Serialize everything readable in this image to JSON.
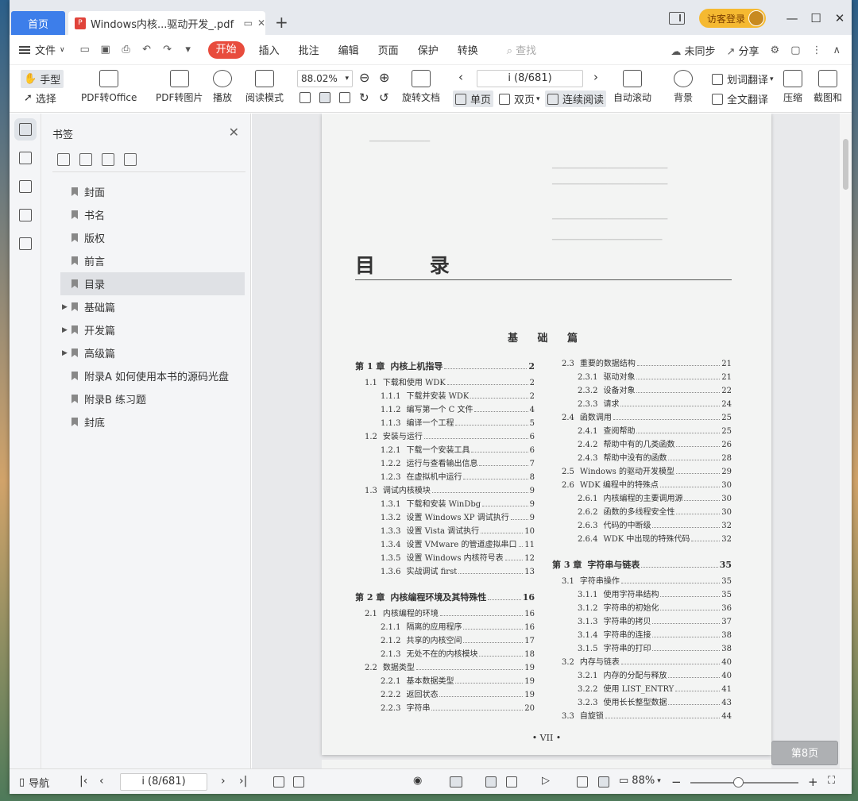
{
  "titlebar": {
    "home_tab": "首页",
    "doc_tab": "Windows内核...驱动开发_.pdf",
    "guest_login": "访客登录"
  },
  "menubar": {
    "file": "文件",
    "tabs": [
      "开始",
      "插入",
      "批注",
      "编辑",
      "页面",
      "保护",
      "转换"
    ],
    "search_placeholder": "查找",
    "sync": "未同步",
    "share": "分享"
  },
  "toolbar": {
    "hand": "手型",
    "select": "选择",
    "pdf_to_office": "PDF转Office",
    "pdf_to_image": "PDF转图片",
    "play": "播放",
    "read_mode": "阅读模式",
    "zoom": "88.02%",
    "page_indicator": "i (8/681)",
    "rotate": "旋转文档",
    "single": "单页",
    "double": "双页",
    "continuous": "连续阅读",
    "autoscroll": "自动滚动",
    "background": "背景",
    "word_translate": "划词翻译",
    "full_translate": "全文翻译",
    "compress": "压缩",
    "screenshot": "截图和"
  },
  "sidebar": {
    "title": "书签",
    "bookmarks": [
      {
        "label": "封面",
        "expandable": false
      },
      {
        "label": "书名",
        "expandable": false
      },
      {
        "label": "版权",
        "expandable": false
      },
      {
        "label": "前言",
        "expandable": false
      },
      {
        "label": "目录",
        "expandable": false,
        "selected": true
      },
      {
        "label": "基础篇",
        "expandable": true
      },
      {
        "label": "开发篇",
        "expandable": true
      },
      {
        "label": "高级篇",
        "expandable": true
      },
      {
        "label": "附录A  如何使用本书的源码光盘",
        "expandable": false
      },
      {
        "label": "附录B  练习题",
        "expandable": false
      },
      {
        "label": "封底",
        "expandable": false
      }
    ]
  },
  "page": {
    "title": "目 录",
    "section": "基 础 篇",
    "folio": "• VII •",
    "badge": "第8页",
    "left_col": [
      {
        "level": 0,
        "num": "第 1 章",
        "text": "内核上机指导",
        "page": "2"
      },
      {
        "level": 1,
        "num": "1.1",
        "text": "下载和使用 WDK",
        "page": "2"
      },
      {
        "level": 2,
        "num": "1.1.1",
        "text": "下载并安装 WDK",
        "page": "2"
      },
      {
        "level": 2,
        "num": "1.1.2",
        "text": "编写第一个 C 文件",
        "page": "4"
      },
      {
        "level": 2,
        "num": "1.1.3",
        "text": "编译一个工程",
        "page": "5"
      },
      {
        "level": 1,
        "num": "1.2",
        "text": "安装与运行",
        "page": "6"
      },
      {
        "level": 2,
        "num": "1.2.1",
        "text": "下载一个安装工具",
        "page": "6"
      },
      {
        "level": 2,
        "num": "1.2.2",
        "text": "运行与查看输出信息",
        "page": "7"
      },
      {
        "level": 2,
        "num": "1.2.3",
        "text": "在虚拟机中运行",
        "page": "8"
      },
      {
        "level": 1,
        "num": "1.3",
        "text": "调试内核模块",
        "page": "9"
      },
      {
        "level": 2,
        "num": "1.3.1",
        "text": "下载和安装 WinDbg",
        "page": "9"
      },
      {
        "level": 2,
        "num": "1.3.2",
        "text": "设置 Windows XP 调试执行",
        "page": "9"
      },
      {
        "level": 2,
        "num": "1.3.3",
        "text": "设置 Vista 调试执行",
        "page": "10"
      },
      {
        "level": 2,
        "num": "1.3.4",
        "text": "设置 VMware 的管道虚拟串口",
        "page": "11"
      },
      {
        "level": 2,
        "num": "1.3.5",
        "text": "设置 Windows 内核符号表",
        "page": "12"
      },
      {
        "level": 2,
        "num": "1.3.6",
        "text": "实战调试 first",
        "page": "13"
      },
      {
        "level": 0,
        "num": "第 2 章",
        "text": "内核编程环境及其特殊性",
        "page": "16",
        "gap": true
      },
      {
        "level": 1,
        "num": "2.1",
        "text": "内核编程的环境",
        "page": "16"
      },
      {
        "level": 2,
        "num": "2.1.1",
        "text": "隔离的应用程序",
        "page": "16"
      },
      {
        "level": 2,
        "num": "2.1.2",
        "text": "共享的内核空间",
        "page": "17"
      },
      {
        "level": 2,
        "num": "2.1.3",
        "text": "无处不在的内核模块",
        "page": "18"
      },
      {
        "level": 1,
        "num": "2.2",
        "text": "数据类型",
        "page": "19"
      },
      {
        "level": 2,
        "num": "2.2.1",
        "text": "基本数据类型",
        "page": "19"
      },
      {
        "level": 2,
        "num": "2.2.2",
        "text": "返回状态",
        "page": "19"
      },
      {
        "level": 2,
        "num": "2.2.3",
        "text": "字符串",
        "page": "20"
      }
    ],
    "right_col": [
      {
        "level": 1,
        "num": "2.3",
        "text": "重要的数据结构",
        "page": "21"
      },
      {
        "level": 2,
        "num": "2.3.1",
        "text": "驱动对象",
        "page": "21"
      },
      {
        "level": 2,
        "num": "2.3.2",
        "text": "设备对象",
        "page": "22"
      },
      {
        "level": 2,
        "num": "2.3.3",
        "text": "请求",
        "page": "24"
      },
      {
        "level": 1,
        "num": "2.4",
        "text": "函数调用",
        "page": "25"
      },
      {
        "level": 2,
        "num": "2.4.1",
        "text": "查阅帮助",
        "page": "25"
      },
      {
        "level": 2,
        "num": "2.4.2",
        "text": "帮助中有的几类函数",
        "page": "26"
      },
      {
        "level": 2,
        "num": "2.4.3",
        "text": "帮助中没有的函数",
        "page": "28"
      },
      {
        "level": 1,
        "num": "2.5",
        "text": "Windows 的驱动开发模型",
        "page": "29"
      },
      {
        "level": 1,
        "num": "2.6",
        "text": "WDK 编程中的特殊点",
        "page": "30"
      },
      {
        "level": 2,
        "num": "2.6.1",
        "text": "内核编程的主要调用源",
        "page": "30"
      },
      {
        "level": 2,
        "num": "2.6.2",
        "text": "函数的多线程安全性",
        "page": "30"
      },
      {
        "level": 2,
        "num": "2.6.3",
        "text": "代码的中断级",
        "page": "32"
      },
      {
        "level": 2,
        "num": "2.6.4",
        "text": "WDK 中出现的特殊代码",
        "page": "32"
      },
      {
        "level": 0,
        "num": "第 3 章",
        "text": "字符串与链表",
        "page": "35",
        "gap": true
      },
      {
        "level": 1,
        "num": "3.1",
        "text": "字符串操作",
        "page": "35"
      },
      {
        "level": 2,
        "num": "3.1.1",
        "text": "使用字符串结构",
        "page": "35"
      },
      {
        "level": 2,
        "num": "3.1.2",
        "text": "字符串的初始化",
        "page": "36"
      },
      {
        "level": 2,
        "num": "3.1.3",
        "text": "字符串的拷贝",
        "page": "37"
      },
      {
        "level": 2,
        "num": "3.1.4",
        "text": "字符串的连接",
        "page": "38"
      },
      {
        "level": 2,
        "num": "3.1.5",
        "text": "字符串的打印",
        "page": "38"
      },
      {
        "level": 1,
        "num": "3.2",
        "text": "内存与链表",
        "page": "40"
      },
      {
        "level": 2,
        "num": "3.2.1",
        "text": "内存的分配与释放",
        "page": "40"
      },
      {
        "level": 2,
        "num": "3.2.2",
        "text": "使用 LIST_ENTRY",
        "page": "41"
      },
      {
        "level": 2,
        "num": "3.2.3",
        "text": "使用长长整型数据",
        "page": "43"
      },
      {
        "level": 1,
        "num": "3.3",
        "text": "自旋锁",
        "page": "44"
      }
    ]
  },
  "statusbar": {
    "nav": "导航",
    "page_indicator": "i (8/681)",
    "zoom": "88%"
  }
}
